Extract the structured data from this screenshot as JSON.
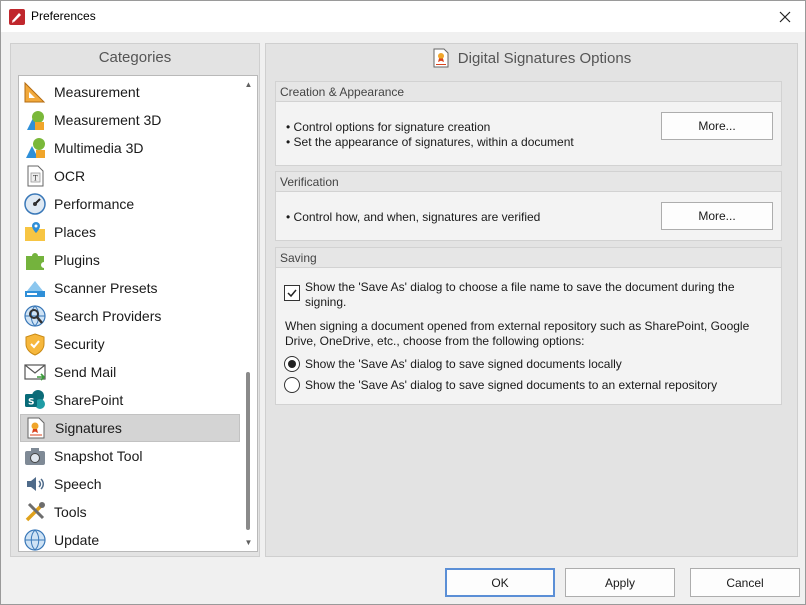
{
  "window": {
    "title": "Preferences"
  },
  "categories": {
    "header": "Categories",
    "items": [
      {
        "label": "Measurement",
        "icon": "ruler-triangle-icon"
      },
      {
        "label": "Measurement 3D",
        "icon": "shapes-3d-icon"
      },
      {
        "label": "Multimedia 3D",
        "icon": "multimedia-3d-icon"
      },
      {
        "label": "OCR",
        "icon": "ocr-icon"
      },
      {
        "label": "Performance",
        "icon": "gauge-icon"
      },
      {
        "label": "Places",
        "icon": "folder-pin-icon"
      },
      {
        "label": "Plugins",
        "icon": "puzzle-icon"
      },
      {
        "label": "Scanner Presets",
        "icon": "scanner-icon"
      },
      {
        "label": "Search Providers",
        "icon": "globe-search-icon"
      },
      {
        "label": "Security",
        "icon": "shield-icon"
      },
      {
        "label": "Send Mail",
        "icon": "envelope-icon"
      },
      {
        "label": "SharePoint",
        "icon": "sharepoint-icon"
      },
      {
        "label": "Signatures",
        "icon": "signature-document-icon",
        "selected": true
      },
      {
        "label": "Snapshot Tool",
        "icon": "camera-icon"
      },
      {
        "label": "Speech",
        "icon": "speaker-icon"
      },
      {
        "label": "Tools",
        "icon": "tools-icon"
      },
      {
        "label": "Update",
        "icon": "globe-update-icon"
      }
    ]
  },
  "options": {
    "title": "Digital Signatures Options",
    "creation": {
      "heading": "Creation & Appearance",
      "line1": "• Control options for signature creation",
      "line2": "• Set the appearance of signatures, within a document",
      "more_label": "More..."
    },
    "verification": {
      "heading": "Verification",
      "line1": "• Control how, and when, signatures are verified",
      "more_label": "More..."
    },
    "saving": {
      "heading": "Saving",
      "checkbox_label_1": "Show the 'Save As' dialog to choose a file name to save the document during the",
      "checkbox_label_2": "signing.",
      "checkbox_checked": true,
      "info_1": "When signing a document opened from external repository such as SharePoint, Google",
      "info_2": "Drive, OneDrive, etc., choose from the following options:",
      "radio_local_label": "Show the 'Save As' dialog to save signed documents locally",
      "radio_external_label": "Show the 'Save As' dialog to save signed documents to an external repository",
      "selected_radio": "local"
    }
  },
  "footer": {
    "ok_label": "OK",
    "apply_label": "Apply",
    "cancel_label": "Cancel"
  }
}
